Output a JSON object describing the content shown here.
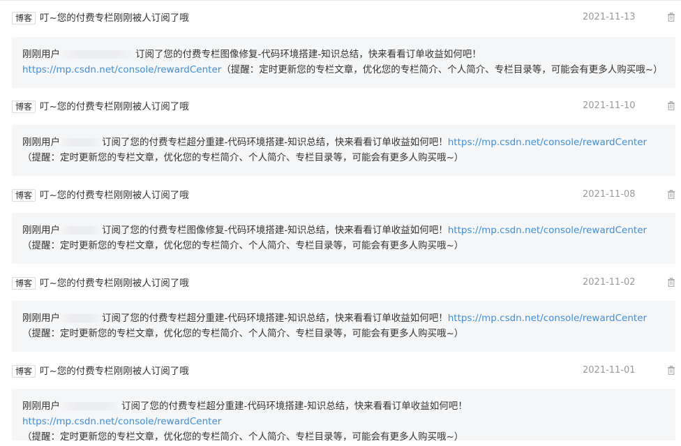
{
  "items": [
    {
      "tag": "博客",
      "title": "叮~您的付费专栏刚刚被人订阅了哦",
      "date": "2021-11-13",
      "user_prefix": "刚刚用户",
      "text_before_link": "订阅了您的付费专栏图像修复-代码环境搭建-知识总结，快来看看订单收益如何吧！",
      "link": "https://mp.csdn.net/console/rewardCenter",
      "text_after_link": "（提醒：定时更新您的专栏文章，优化您的专栏简介、个人简介、专栏目录等，可能会有更多人购买哦~）"
    },
    {
      "tag": "博客",
      "title": "叮~您的付费专栏刚刚被人订阅了哦",
      "date": "2021-11-10",
      "user_prefix": "刚刚用户",
      "text_before_link": "订阅了您的付费专栏超分重建-代码环境搭建-知识总结，快来看看订单收益如何吧！",
      "link": "https://mp.csdn.net/console/rewardCenter",
      "text_after_link": "（提醒：定时更新您的专栏文章，优化您的专栏简介、个人简介、专栏目录等，可能会有更多人购买哦~）"
    },
    {
      "tag": "博客",
      "title": "叮~您的付费专栏刚刚被人订阅了哦",
      "date": "2021-11-08",
      "user_prefix": "刚刚用户",
      "text_before_link": "订阅了您的付费专栏图像修复-代码环境搭建-知识总结，快来看看订单收益如何吧！",
      "link": "https://mp.csdn.net/console/rewardCenter",
      "text_after_link": "（提醒：定时更新您的专栏文章，优化您的专栏简介、个人简介、专栏目录等，可能会有更多人购买哦~）"
    },
    {
      "tag": "博客",
      "title": "叮~您的付费专栏刚刚被人订阅了哦",
      "date": "2021-11-02",
      "user_prefix": "刚刚用户",
      "text_before_link": "订阅了您的付费专栏超分重建-代码环境搭建-知识总结，快来看看订单收益如何吧！",
      "link": "https://mp.csdn.net/console/rewardCenter",
      "text_after_link": "（提醒：定时更新您的专栏文章，优化您的专栏简介、个人简介、专栏目录等，可能会有更多人购买哦~）"
    },
    {
      "tag": "博客",
      "title": "叮~您的付费专栏刚刚被人订阅了哦",
      "date": "2021-11-01",
      "user_prefix": "刚刚用户",
      "text_before_link": "订阅了您的付费专栏超分重建-代码环境搭建-知识总结，快来看看订单收益如何吧！",
      "link": "https://mp.csdn.net/console/rewardCenter",
      "text_after_link": "（提醒：定时更新您的专栏文章，优化您的专栏简介、个人简介、专栏目录等，可能会有更多人购买哦~）"
    }
  ],
  "icons": {
    "delete": "trash-icon"
  },
  "colors": {
    "link": "#3f8ed6",
    "date": "#999999",
    "body_bg": "#f5f6f7",
    "text": "#333333"
  }
}
